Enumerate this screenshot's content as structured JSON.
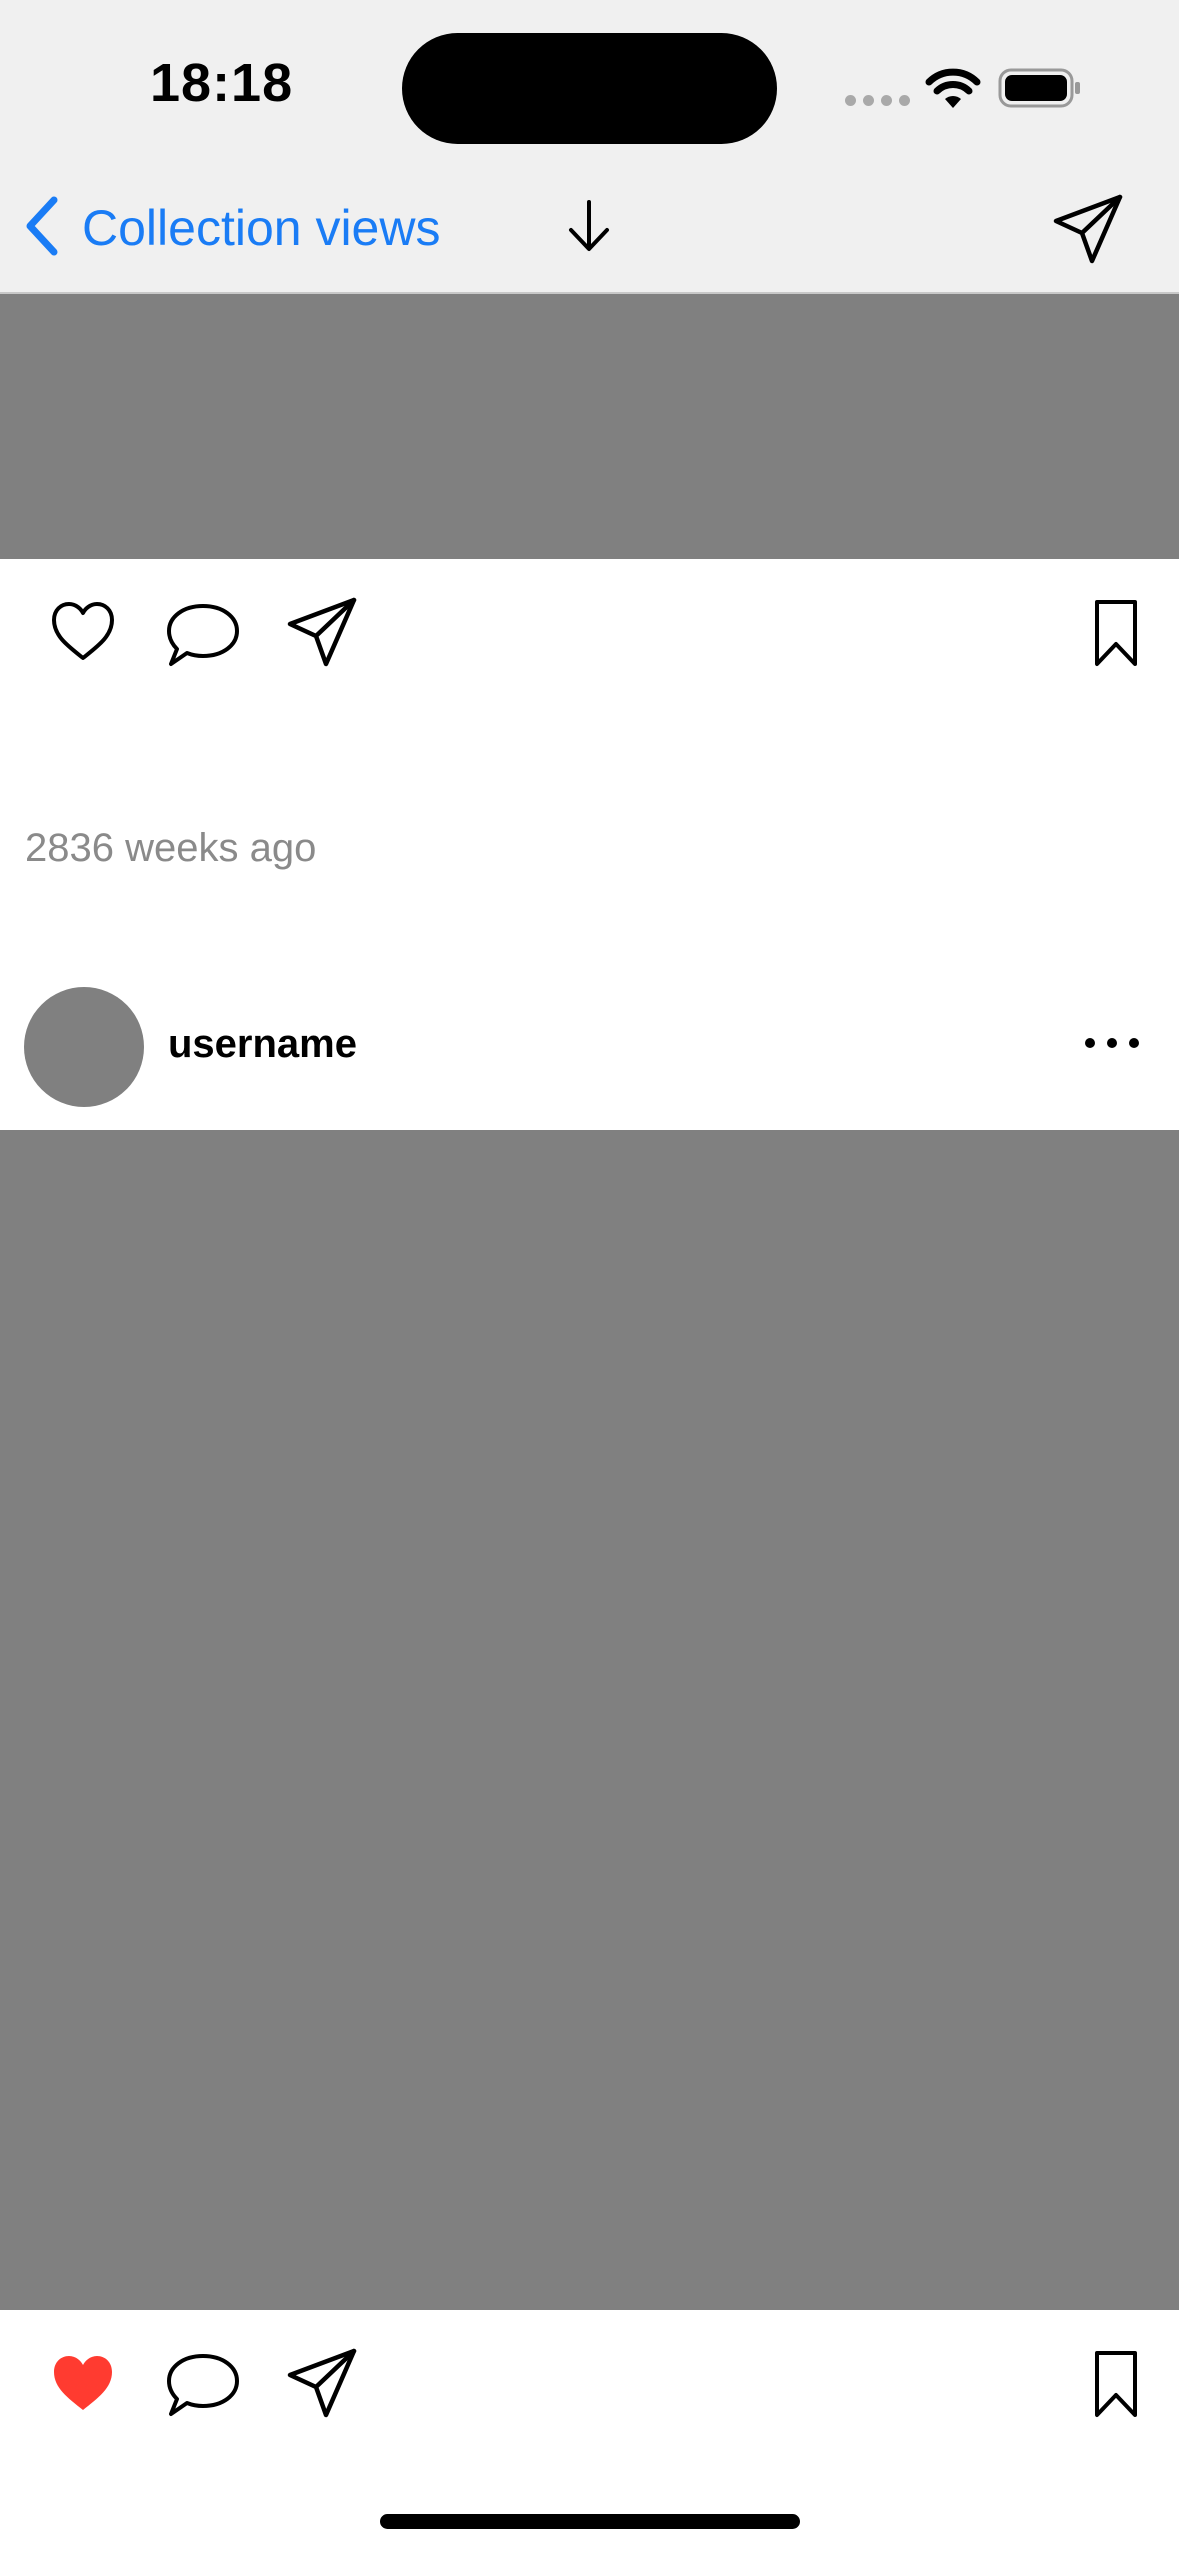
{
  "status_bar": {
    "time": "18:18",
    "wifi_icon": "wifi-icon",
    "battery_icon": "battery-icon"
  },
  "nav_bar": {
    "back_label": "Collection views",
    "back_icon": "chevron-left-icon",
    "center_icon": "arrow-down-icon",
    "right_icon": "send-icon",
    "accent_color": "#1a7cf5"
  },
  "post_1": {
    "like_icon": "heart-outline-icon",
    "liked": false,
    "comment_icon": "comment-icon",
    "share_icon": "send-icon",
    "bookmark_icon": "bookmark-icon",
    "timestamp": "2836 weeks ago"
  },
  "post_2": {
    "username": "username",
    "more_icon": "ellipsis-icon",
    "like_icon": "heart-filled-icon",
    "liked": true,
    "like_color": "#ff3b30",
    "comment_icon": "comment-icon",
    "share_icon": "send-icon",
    "bookmark_icon": "bookmark-icon"
  },
  "placeholder_color": "#808080"
}
